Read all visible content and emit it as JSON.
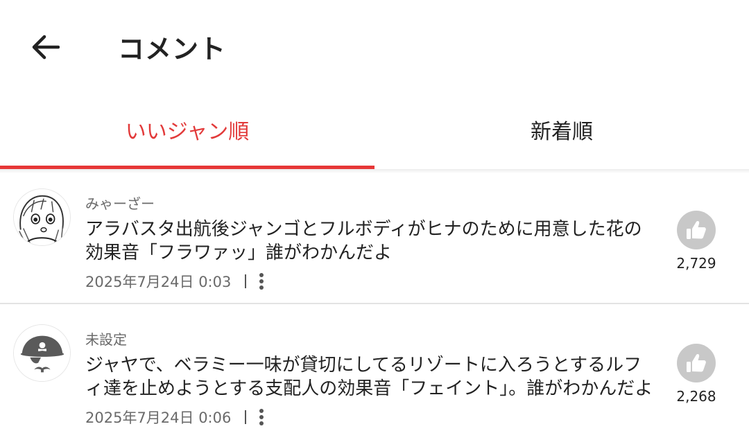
{
  "header": {
    "title": "コメント",
    "back_icon": "arrow-left-icon"
  },
  "tabs": [
    {
      "label": "いいジャン順",
      "active": true
    },
    {
      "label": "新着順",
      "active": false
    }
  ],
  "colors": {
    "accent": "#e23a3a",
    "like_bg": "#c8c8c8",
    "muted": "#6a6a6a"
  },
  "comments": [
    {
      "username": "みゃーざー",
      "text": "アラバスタ出航後ジャンゴとフルボディがヒナのために用意した花の効果音「フラワァッ」誰がわかんだよ",
      "date": "2025年7月24日 0:03",
      "likes": "2,729",
      "avatar_icon": "manga-girl-avatar-icon"
    },
    {
      "username": "未設定",
      "text": "ジャヤで、ベラミー一味が貸切にしてるリゾートに入ろうとするルフィ達を止めようとする支配人の効果音「フェイント」。誰がわかんだよ",
      "date": "2025年7月24日 0:06",
      "likes": "2,268",
      "avatar_icon": "pirate-avatar-icon"
    }
  ]
}
